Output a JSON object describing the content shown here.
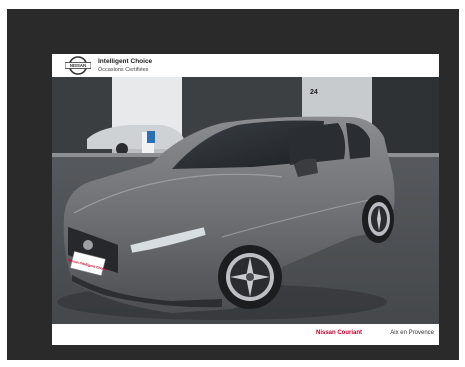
{
  "header": {
    "logo_text": "NISSAN",
    "title": "Intelligent Choice",
    "subtitle": "Occasions Certifiées"
  },
  "photo": {
    "subject": "grey-nissan-qashqai-icon",
    "plate_text": "Nissan Intelligent Choice",
    "building_number": "24"
  },
  "footer": {
    "dealer": "Nissan Couriant",
    "location": "Aix en Provence"
  },
  "colors": {
    "frame": "#2a2a2a",
    "dealer_red": "#c3002f",
    "car_grey": "#6e7074"
  }
}
